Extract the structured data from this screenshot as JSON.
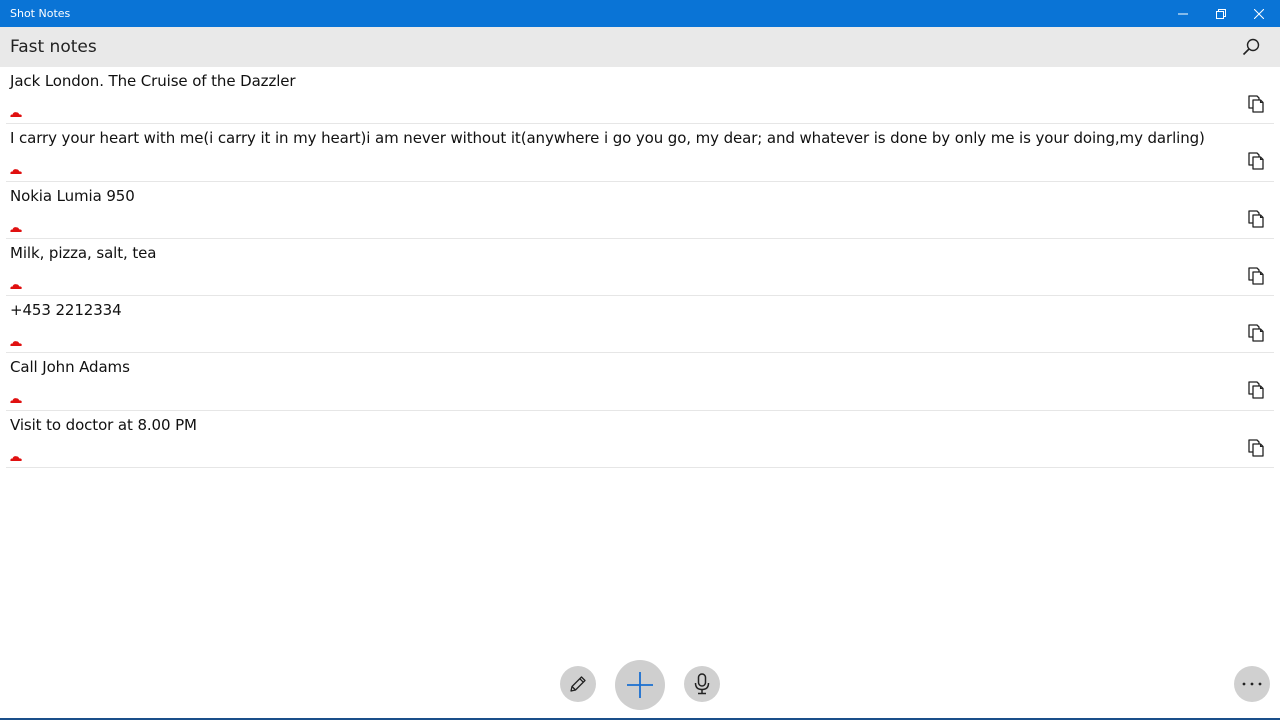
{
  "window": {
    "title": "Shot Notes",
    "minimize_icon": "minimize-icon",
    "maximize_icon": "restore-icon",
    "close_icon": "close-icon"
  },
  "header": {
    "title": "Fast notes",
    "search_icon": "search-icon"
  },
  "notes": [
    {
      "text": "Jack London. The Cruise of the Dazzler"
    },
    {
      "text": "I carry your heart with me(i carry it in my heart)i am never without it(anywhere i go you go, my dear; and whatever is done by only me is your doing,my darling)"
    },
    {
      "text": "Nokia Lumia 950"
    },
    {
      "text": "Milk, pizza, salt, tea"
    },
    {
      "text": "+453 2212334"
    },
    {
      "text": "Call John Adams"
    },
    {
      "text": "Visit to doctor at 8.00 PM"
    }
  ],
  "note_icons": {
    "sync": "cloud-icon",
    "copy": "copy-icon"
  },
  "colors": {
    "titlebar": "#0a74d6",
    "header": "#e9e9e9",
    "cloud": "#e01010",
    "accent": "#1a6fd0"
  },
  "toolbar": {
    "edit_icon": "pencil-icon",
    "add_icon": "plus-icon",
    "mic_icon": "microphone-icon",
    "more_icon": "more-icon"
  }
}
